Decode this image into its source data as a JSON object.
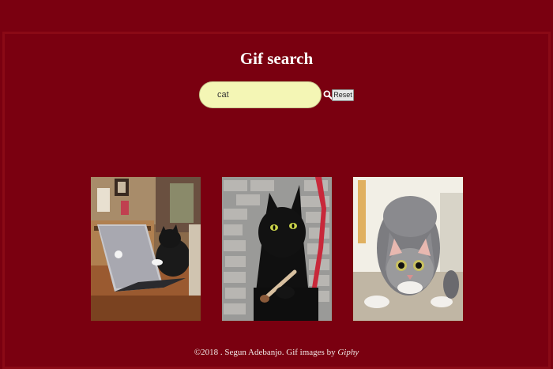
{
  "header": {
    "title": "Gif search"
  },
  "search": {
    "value": "cat",
    "reset_label": "Reset"
  },
  "results": [
    {
      "label": "cat typing on laptop gif"
    },
    {
      "label": "black cat holding brush gif"
    },
    {
      "label": "tabby cat crouching gif"
    }
  ],
  "footer": {
    "copyright": "©2018 . Segun Adebanjo. Gif images by ",
    "credit": "Giphy"
  },
  "colors": {
    "background": "#7a0010",
    "input": "#f4f6b5"
  }
}
